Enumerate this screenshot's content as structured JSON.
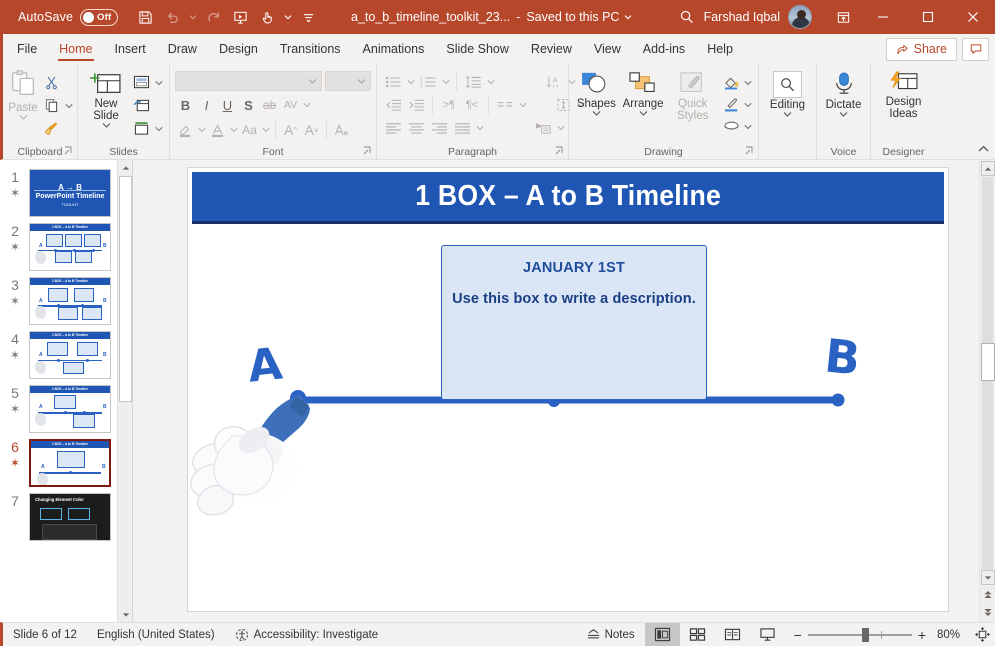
{
  "titlebar": {
    "autosave_label": "AutoSave",
    "autosave_state": "Off",
    "doc_title": "a_to_b_timeline_toolkit_23...",
    "dash": "-",
    "save_location": "Saved to this PC",
    "user_name": "Farshad Iqbal",
    "icons": {
      "save": "save-icon",
      "undo": "undo-icon",
      "redo": "redo-icon",
      "start_slideshow": "start-slideshow-icon",
      "touch_mode": "touch-mode-icon",
      "customize_qat": "customize-quick-access-toolbar-icon",
      "search": "search-icon",
      "ribbon_display": "ribbon-display-options-icon",
      "minimize": "minimize-icon",
      "maximize": "maximize-icon",
      "close": "close-icon"
    }
  },
  "tabs": [
    {
      "label": "File",
      "active": false
    },
    {
      "label": "Home",
      "active": true
    },
    {
      "label": "Insert",
      "active": false
    },
    {
      "label": "Draw",
      "active": false
    },
    {
      "label": "Design",
      "active": false
    },
    {
      "label": "Transitions",
      "active": false
    },
    {
      "label": "Animations",
      "active": false
    },
    {
      "label": "Slide Show",
      "active": false
    },
    {
      "label": "Review",
      "active": false
    },
    {
      "label": "View",
      "active": false
    },
    {
      "label": "Add-ins",
      "active": false
    },
    {
      "label": "Help",
      "active": false
    }
  ],
  "tabs_right": {
    "share_label": "Share",
    "comments_icon": "comment-icon"
  },
  "ribbon": {
    "groups": [
      {
        "name": "Clipboard",
        "label": "Clipboard"
      },
      {
        "name": "Slides",
        "label": "Slides"
      },
      {
        "name": "Font",
        "label": "Font"
      },
      {
        "name": "Paragraph",
        "label": "Paragraph"
      },
      {
        "name": "Drawing",
        "label": "Drawing"
      },
      {
        "name": "Voice",
        "label": "Voice"
      },
      {
        "name": "Designer",
        "label": "Designer"
      }
    ],
    "clipboard": {
      "paste_label": "Paste",
      "cut_icon": "scissors-icon",
      "copy_icon": "copy-icon",
      "format_painter_icon": "format-painter-icon"
    },
    "slides": {
      "new_slide_label": "New Slide",
      "layout_icon": "slide-layout-icon",
      "reset_icon": "reset-slide-icon",
      "section_icon": "section-icon"
    },
    "font": {
      "font_name_value": "",
      "font_size_value": "",
      "bold": "B",
      "italic": "I",
      "underline": "U",
      "shadow": "S",
      "strikethrough": "ab",
      "char_spacing": "AV",
      "change_case": "Aa",
      "increase_size": "A",
      "decrease_size": "A",
      "clear_formatting_icon": "clear-formatting-icon",
      "text_highlight_icon": "text-highlight-color-icon",
      "font_color_icon": "font-color-icon"
    },
    "paragraph": {
      "bullets_icon": "bullets-icon",
      "numbering_icon": "numbering-icon",
      "line_spacing_icon": "line-spacing-icon",
      "text_direction_icon": "text-direction-icon",
      "decrease_indent_icon": "decrease-indent-icon",
      "increase_indent_icon": "increase-indent-icon",
      "ltr_icon": "left-to-right-icon",
      "rtl_icon": "right-to-left-icon",
      "columns_icon": "columns-icon",
      "align_text_icon": "align-text-icon",
      "align_left_icon": "align-left-icon",
      "align_center_icon": "align-center-icon",
      "align_right_icon": "align-right-icon",
      "justify_icon": "justify-icon",
      "convert_smartart_icon": "convert-to-smartart-icon"
    },
    "drawing": {
      "shapes_label": "Shapes",
      "arrange_label": "Arrange",
      "quick_styles_label": "Quick Styles",
      "shape_fill_icon": "shape-fill-icon",
      "shape_outline_icon": "shape-outline-icon",
      "shape_effects_icon": "shape-effects-icon"
    },
    "editing": {
      "label": "Editing",
      "icon": "magnifier-icon"
    },
    "voice": {
      "label": "Dictate",
      "icon": "microphone-icon"
    },
    "designer": {
      "label": "Design Ideas",
      "icon": "design-ideas-icon"
    },
    "collapse_icon": "collapse-ribbon-icon"
  },
  "thumbnails": [
    {
      "number": "1",
      "star": "✶",
      "selected": false,
      "kind": "title"
    },
    {
      "number": "2",
      "star": "✶",
      "selected": false,
      "kind": "content"
    },
    {
      "number": "3",
      "star": "✶",
      "selected": false,
      "kind": "content"
    },
    {
      "number": "4",
      "star": "✶",
      "selected": false,
      "kind": "content"
    },
    {
      "number": "5",
      "star": "✶",
      "selected": false,
      "kind": "content"
    },
    {
      "number": "6",
      "star": "✶",
      "selected": true,
      "kind": "content"
    },
    {
      "number": "7",
      "star": "",
      "selected": false,
      "kind": "dark"
    }
  ],
  "thumb_mini": {
    "title_main": "A → B",
    "title_sub": "PowerPoint Timeline",
    "title_small": "TOOLKIT",
    "content_header": "1 BOX – A to B Timeline",
    "dark_header": "Changing Element Color"
  },
  "slide": {
    "title": "1 BOX – A to B Timeline",
    "box_heading": "JANUARY 1ST",
    "box_body": "Use this box to write a description.",
    "marker_a": "A",
    "marker_b": "B",
    "accent_color": "#2a62c4",
    "title_bar_color": "#1f56b4",
    "box_fill_color": "#dae5f5"
  },
  "statusbar": {
    "slide_counter": "Slide 6 of 12",
    "language": "English (United States)",
    "accessibility": "Accessibility: Investigate",
    "accessibility_icon": "accessibility-icon",
    "notes_label": "Notes",
    "notes_icon": "notes-icon",
    "views": [
      {
        "name": "normal-view",
        "icon": "normal-view-icon",
        "active": true
      },
      {
        "name": "slide-sorter-view",
        "icon": "slide-sorter-icon",
        "active": false
      },
      {
        "name": "reading-view",
        "icon": "reading-view-icon",
        "active": false
      },
      {
        "name": "slide-show-view",
        "icon": "slide-show-icon",
        "active": false
      }
    ],
    "zoom_out": "−",
    "zoom_in": "+",
    "zoom_level": "80%",
    "fit_icon": "fit-slide-to-window-icon"
  }
}
